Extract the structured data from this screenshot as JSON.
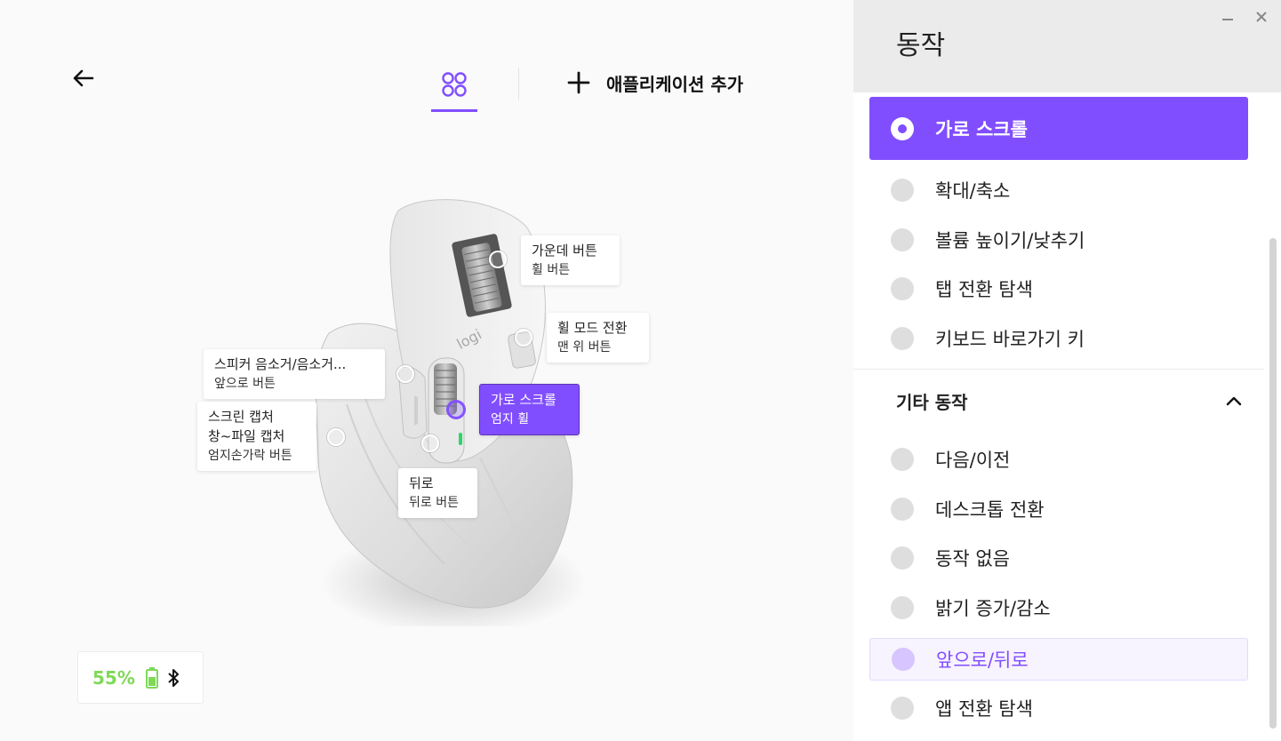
{
  "header": {
    "add_app_label": "애플리케이션 추가"
  },
  "mouse": {
    "logo_text": "logi"
  },
  "callouts": {
    "middle": {
      "title": "가운데 버튼",
      "sub": "휠 버튼"
    },
    "mode": {
      "title": "휠 모드 전환",
      "sub": "맨 위 버튼"
    },
    "forward": {
      "title": "스피커 음소거/음소거...",
      "sub": "앞으로 버튼"
    },
    "thumb_wheel": {
      "title": "가로 스크롤",
      "sub": "엄지 휠"
    },
    "gesture": {
      "title": "스크린 캡처",
      "line2": "창~파일 캡처",
      "sub": "엄지손가락 버튼"
    },
    "back": {
      "title": "뒤로",
      "sub": "뒤로 버튼"
    }
  },
  "battery": {
    "percent": "55%"
  },
  "panel": {
    "title": "동작",
    "options_top": [
      {
        "label": "가로 스크롤",
        "selected": true
      },
      {
        "label": "확대/축소"
      },
      {
        "label": "볼륨 높이기/낮추기"
      },
      {
        "label": "탭 전환 탐색"
      },
      {
        "label": "키보드 바로가기 키"
      }
    ],
    "section_title": "기타 동작",
    "options_other": [
      {
        "label": "다음/이전"
      },
      {
        "label": "데스크톱 전환"
      },
      {
        "label": "동작 없음"
      },
      {
        "label": "밝기 증가/감소"
      },
      {
        "label": "앞으로/뒤로",
        "hovered": true
      },
      {
        "label": "앱 전환 탐색"
      }
    ]
  },
  "colors": {
    "accent": "#814eff",
    "battery": "#7ed957",
    "panel_header": "#ebebeb"
  }
}
